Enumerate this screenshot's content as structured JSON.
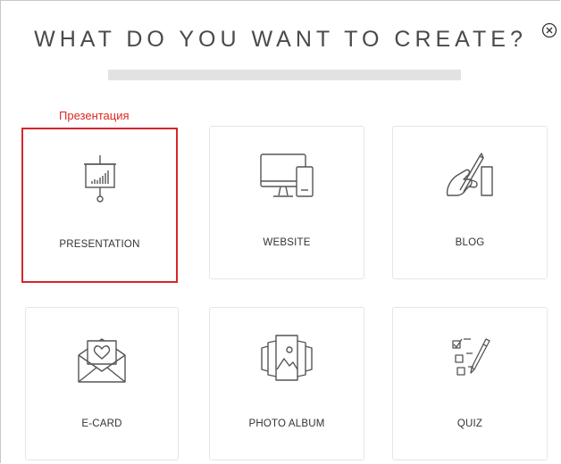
{
  "dialog": {
    "title": "WHAT DO YOU WANT TO CREATE?",
    "close_icon": "close-circle-icon",
    "annotation": "Презентация",
    "annotation_color": "#e0261c"
  },
  "options": [
    {
      "label": "PRESENTATION",
      "icon": "presentation-board-icon",
      "selected": true
    },
    {
      "label": "WEBSITE",
      "icon": "desktop-mobile-icon",
      "selected": false
    },
    {
      "label": "BLOG",
      "icon": "hand-writing-icon",
      "selected": false
    },
    {
      "label": "E-CARD",
      "icon": "envelope-heart-icon",
      "selected": false
    },
    {
      "label": "PHOTO ALBUM",
      "icon": "photo-stack-icon",
      "selected": false
    },
    {
      "label": "QUIZ",
      "icon": "checklist-pencil-icon",
      "selected": false
    }
  ],
  "colors": {
    "selection_border": "#d4272b",
    "card_border": "#e6e6e6",
    "progress_bar": "#e2e2e2"
  }
}
